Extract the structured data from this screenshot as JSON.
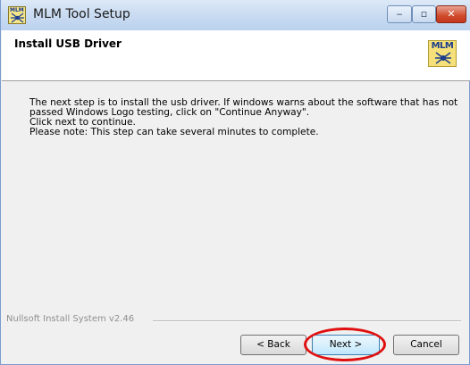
{
  "window": {
    "title": "MLM Tool Setup",
    "app_icon_text": "MLM",
    "caption_buttons": {
      "minimize": "‒",
      "maximize": "▫",
      "close": "✕"
    }
  },
  "header": {
    "title": "Install USB Driver",
    "logo_text": "MLM"
  },
  "body": {
    "lines": [
      "The next step is to install the usb driver. If windows warns about the software that has not",
      "passed Windows Logo testing, click on \"Continue Anyway\".",
      "Click next to continue.",
      "Please note: This step can take several minutes to complete."
    ]
  },
  "footer": {
    "brand": "Nullsoft Install System v2.46",
    "buttons": {
      "back": "< Back",
      "next": "Next >",
      "cancel": "Cancel"
    }
  },
  "colors": {
    "highlight": "#e01010",
    "titlebar": "#c7daf1",
    "close_button": "#cf4a2c"
  }
}
